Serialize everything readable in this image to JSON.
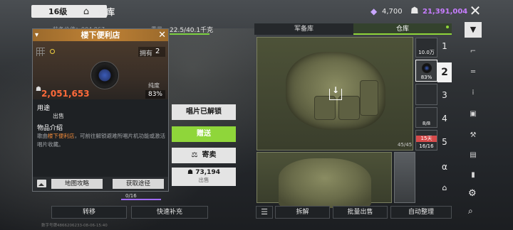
{
  "header": {
    "level": "16级",
    "title": "仓库",
    "diamonds": "4,700",
    "coins": "21,391,004"
  },
  "background": {
    "ghost_label": "装备价值：904,867",
    "weight_label": "重量:",
    "weight_value": "22.5/40.1千克",
    "slot_count": "0/16",
    "footnote": "数字号牌4866206233-08-06-15:40"
  },
  "popup": {
    "title": "楼下便利店",
    "own_label": "拥有",
    "own_count": "2",
    "purity_label": "纯度",
    "purity_value": "83%",
    "price": "2,051,653",
    "use_title": "用途",
    "use_value": "出售",
    "intro_title": "物品介绍",
    "desc_prefix": "歌曲",
    "desc_highlight": "楼下便利店",
    "desc_rest": "，可前往解锁避难所唱片机功能或激活唱片收藏。",
    "map_button": "地图攻略",
    "get_button": "获取途径"
  },
  "actions": {
    "unlock": "唱片已解锁",
    "gift": "赠送",
    "consign": "寄卖",
    "sell_price": "73,194",
    "sell_label": "出售"
  },
  "left_bottom": {
    "transfer": "转移",
    "quick_refill": "快速补充"
  },
  "right": {
    "tab_armory": "军备库",
    "tab_warehouse": "仓库",
    "slot_capacity": "45/45",
    "slots": [
      {
        "caption": "10.0万"
      },
      {
        "caption": "83%"
      },
      {
        "caption": ""
      },
      {
        "caption": "8/8"
      },
      {
        "caption": "16/16",
        "tag": "15天"
      }
    ],
    "page_numbers": [
      "1",
      "2",
      "3",
      "4",
      "5",
      "α"
    ],
    "active_page": "2",
    "disassemble": "拆解",
    "bulk_sell": "批量出售",
    "auto_sort": "自动整理"
  },
  "colors": {
    "accent_green": "#8fd63a",
    "price_orange": "#ff6a3a",
    "coin_purple": "#c77dff",
    "header_orange": "#c08235"
  }
}
